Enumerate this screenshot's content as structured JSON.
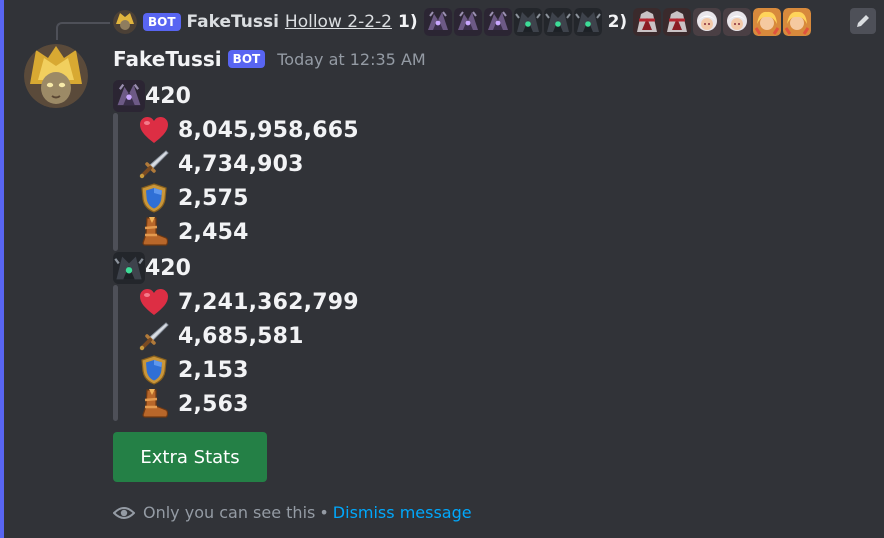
{
  "reply": {
    "bot_tag": "BOT",
    "username": "FakeTussi",
    "link_text": "Hollow 2-2-2",
    "group1_label": "1)",
    "group2_label": "2)",
    "group1_icons": [
      "dark-hero-icon",
      "dark-hero-icon",
      "dark-hero-icon",
      "dark-green-hero-icon",
      "dark-green-hero-icon",
      "dark-green-hero-icon"
    ],
    "group2_icons": [
      "red-armor-hero-icon",
      "red-armor-hero-icon",
      "white-hair-hero-icon",
      "white-hair-hero-icon",
      "blonde-hero-icon",
      "blonde-hero-icon"
    ]
  },
  "message": {
    "username": "FakeTussi",
    "bot_tag": "BOT",
    "timestamp": "Today at 12:35 AM"
  },
  "blocks": [
    {
      "level": "420",
      "icon": "dark-hero-icon",
      "stats": [
        {
          "icon": "heart-icon",
          "value": "8,045,958,665"
        },
        {
          "icon": "sword-icon",
          "value": "4,734,903"
        },
        {
          "icon": "shield-icon",
          "value": "2,575"
        },
        {
          "icon": "boot-icon",
          "value": "2,454"
        }
      ]
    },
    {
      "level": "420",
      "icon": "dark-green-hero-icon",
      "stats": [
        {
          "icon": "heart-icon",
          "value": "7,241,362,799"
        },
        {
          "icon": "sword-icon",
          "value": "4,685,581"
        },
        {
          "icon": "shield-icon",
          "value": "2,153"
        },
        {
          "icon": "boot-icon",
          "value": "2,563"
        }
      ]
    }
  ],
  "button": {
    "label": "Extra Stats",
    "color": "#248046"
  },
  "footer": {
    "ephemeral_text": "Only you can see this",
    "separator": "•",
    "dismiss_text": "Dismiss message"
  },
  "colors": {
    "background": "#313338",
    "accent": "#5865f2",
    "link": "#00a8fc"
  }
}
